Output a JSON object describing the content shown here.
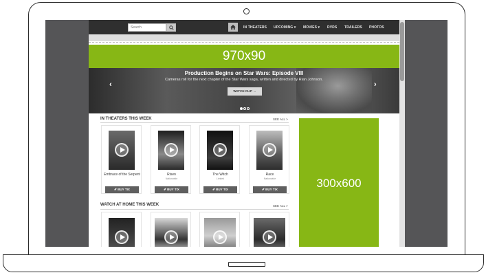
{
  "search": {
    "placeholder": "Search"
  },
  "nav": {
    "links": [
      "IN THEATERS",
      "UPCOMING ▾",
      "MOVIES ▾",
      "DVDS",
      "TRAILERS",
      "PHOTOS"
    ]
  },
  "ads": {
    "leaderboard": "970x90",
    "sidebar": "300x600"
  },
  "hero": {
    "title": "Production Begins on Star Wars: Episode VIII",
    "subtitle": "Cameras roll for the next chapter of the Star Wars saga, written and directed by Rian Johnson.",
    "button": "WATCH CLIP →",
    "prev": "‹",
    "next": "›",
    "slides": 3,
    "active_slide": 1
  },
  "in_theaters": {
    "title": "IN THEATERS THIS WEEK",
    "see_all": "SEE ALL >",
    "buy_label": "BUY TIX",
    "movies": [
      {
        "title": "Embrace of the Serpent",
        "sub": ""
      },
      {
        "title": "Risen",
        "sub": "Nationwide"
      },
      {
        "title": "The Witch",
        "sub": "Limited"
      },
      {
        "title": "Race",
        "sub": "Nationwide"
      }
    ]
  },
  "at_home": {
    "title": "WATCH AT HOME THIS WEEK",
    "see_all": "SEE ALL >"
  },
  "colors": {
    "accent": "#87b715",
    "nav": "#2f2f2f",
    "button": "#5f5f5f"
  },
  "icons": [
    "search-icon",
    "home-icon",
    "ticket-icon",
    "play-icon"
  ]
}
